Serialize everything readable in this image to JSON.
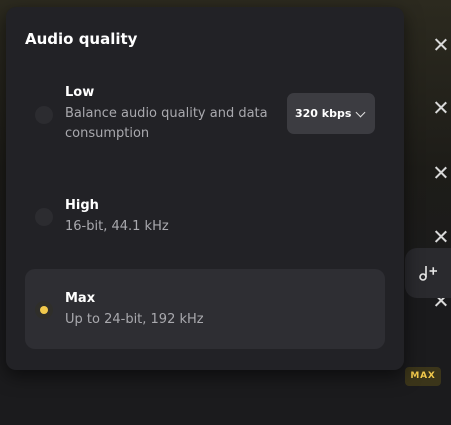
{
  "dialog": {
    "title": "Audio quality"
  },
  "options": [
    {
      "title": "Low",
      "description": "Balance audio quality and data consumption",
      "selected": false
    },
    {
      "title": "High",
      "description": "16-bit, 44.1 kHz",
      "selected": false
    },
    {
      "title": "Max",
      "description": "Up to 24-bit, 192 kHz",
      "selected": true
    }
  ],
  "bitrate_select": {
    "value": "320 kbps"
  },
  "badge": {
    "label": "MAX"
  },
  "icons": {
    "close": "close-icon",
    "chevron": "chevron-down-icon",
    "add_track": "add-track-icon"
  },
  "colors": {
    "accent": "#f2c94c",
    "panel": "#222226",
    "selected_row": "#2e2e33"
  }
}
